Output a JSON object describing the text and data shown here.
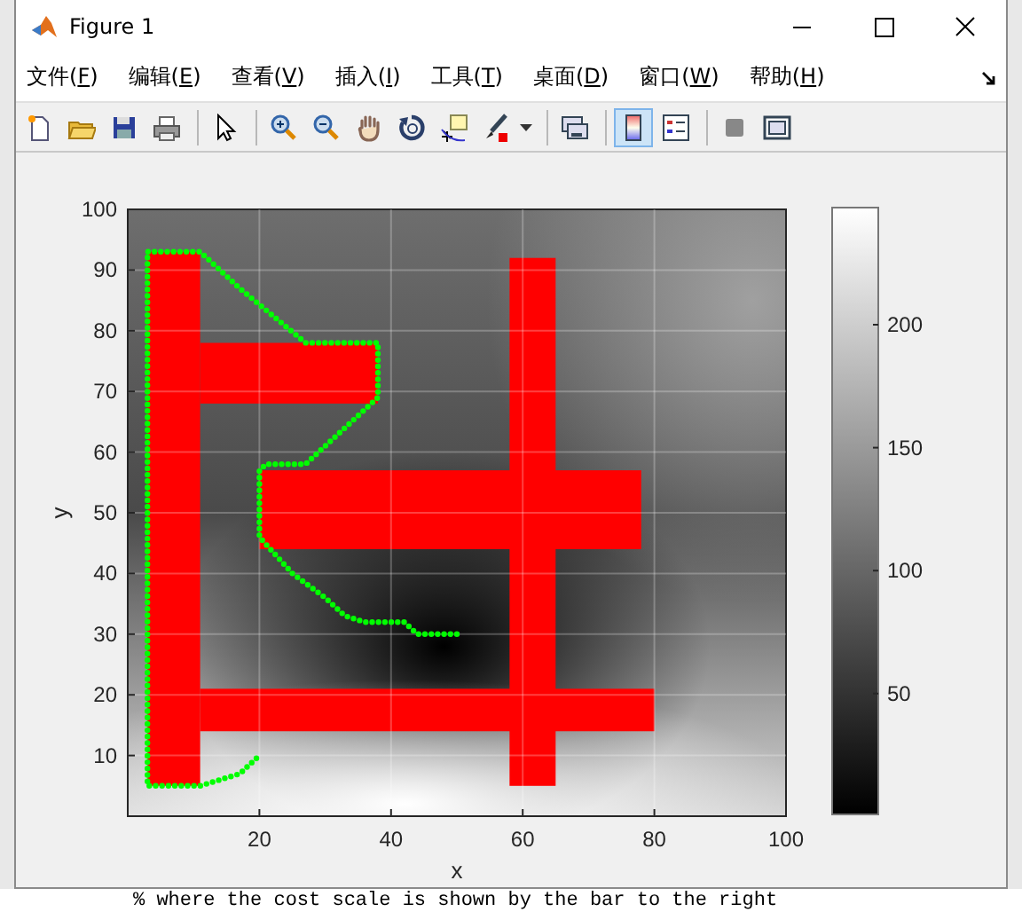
{
  "window": {
    "title": "Figure 1"
  },
  "menu": [
    {
      "label": "文件(F)"
    },
    {
      "label": "编辑(E)"
    },
    {
      "label": "查看(V)"
    },
    {
      "label": "插入(I)"
    },
    {
      "label": "工具(T)"
    },
    {
      "label": "桌面(D)"
    },
    {
      "label": "窗口(W)"
    },
    {
      "label": "帮助(H)"
    }
  ],
  "toolbar": [
    [
      {
        "pressed": false
      },
      {
        "pressed": false
      },
      {
        "pressed": false
      },
      {
        "pressed": false
      }
    ],
    [
      {
        "pressed": false
      }
    ],
    [
      {
        "pressed": false
      },
      {
        "pressed": false
      },
      {
        "pressed": false
      },
      {
        "pressed": false
      },
      {
        "pressed": false
      },
      {
        "pressed": false
      }
    ],
    [
      {
        "pressed": false
      }
    ],
    [
      {
        "pressed": true
      },
      {
        "pressed": false
      }
    ],
    [
      {
        "pressed": false
      },
      {
        "pressed": false
      }
    ]
  ],
  "axes": {
    "chart_data": {
      "type": "line",
      "xlabel": "x",
      "ylabel": "y",
      "xlim": [
        0,
        100
      ],
      "ylim": [
        0,
        100
      ],
      "xticks": [
        {
          "value": 20,
          "label": "20"
        },
        {
          "value": 40,
          "label": "40"
        },
        {
          "value": 60,
          "label": "60"
        },
        {
          "value": 80,
          "label": "80"
        },
        {
          "value": 100,
          "label": "100"
        }
      ],
      "yticks": [
        {
          "value": 10,
          "label": "10"
        },
        {
          "value": 20,
          "label": "20"
        },
        {
          "value": 30,
          "label": "30"
        },
        {
          "value": 40,
          "label": "40"
        },
        {
          "value": 50,
          "label": "50"
        },
        {
          "value": 60,
          "label": "60"
        },
        {
          "value": 70,
          "label": "70"
        },
        {
          "value": 80,
          "label": "80"
        },
        {
          "value": 90,
          "label": "90"
        },
        {
          "value": 100,
          "label": "100"
        }
      ],
      "x": [
        50,
        44,
        42,
        36,
        33,
        30,
        25,
        20,
        20,
        21,
        27,
        38,
        38,
        27,
        17,
        11,
        3,
        3,
        11,
        17,
        20
      ],
      "grid": true,
      "series": [
        {
          "color": "#00ff00",
          "line_style": "dotted",
          "values": [
            30,
            30,
            32,
            32,
            33,
            36,
            40,
            46,
            57,
            58,
            58,
            69,
            78,
            78,
            87,
            93,
            93,
            5,
            5,
            7,
            10
          ]
        }
      ]
    }
  },
  "colorbar": {
    "ticks": [
      "200",
      "150",
      "100",
      "50"
    ]
  },
  "editor": {
    "code_line": "% where the cost scale is shown by the bar to the right"
  }
}
